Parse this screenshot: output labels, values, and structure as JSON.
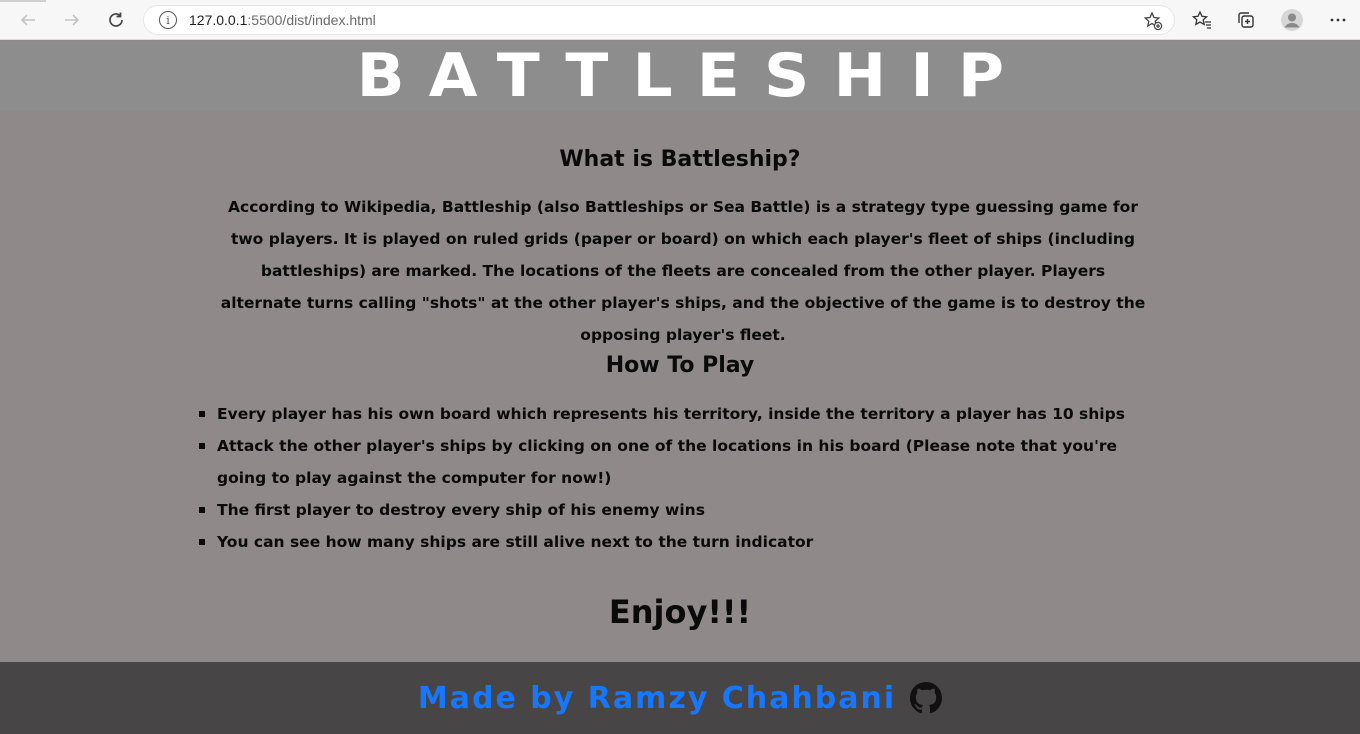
{
  "browser": {
    "url_host": "127.0.0.1",
    "url_path": ":5500/dist/index.html"
  },
  "header": {
    "title": "BATTLESHIP"
  },
  "main": {
    "what_heading": "What is Battleship?",
    "what_text": "According to Wikipedia, Battleship (also Battleships or Sea Battle) is a strategy type guessing game for two players. It is played on ruled grids (paper or board) on which each player's fleet of ships (including battleships) are marked. The locations of the fleets are concealed from the other player. Players alternate turns calling \"shots\" at the other player's ships, and the objective of the game is to destroy the opposing player's fleet.",
    "how_heading": "How To Play",
    "rules": [
      "Every player has his own board which represents his territory, inside the territory a player has 10 ships",
      "Attack the other player's ships by clicking on one of the locations in his board (Please note that you're going to play against the computer for now!)",
      "The first player to destroy every ship of his enemy wins",
      "You can see how many ships are still alive next to the turn indicator"
    ],
    "enjoy": "Enjoy!!!"
  },
  "footer": {
    "text": "Made by Ramzy Chahbani",
    "link_color": "#1877ff"
  },
  "icons": [
    "back-arrow-icon",
    "forward-arrow-icon",
    "reload-icon",
    "info-icon",
    "add-favorite-icon",
    "favorites-icon",
    "collections-icon",
    "profile-icon",
    "more-icon",
    "github-icon"
  ]
}
